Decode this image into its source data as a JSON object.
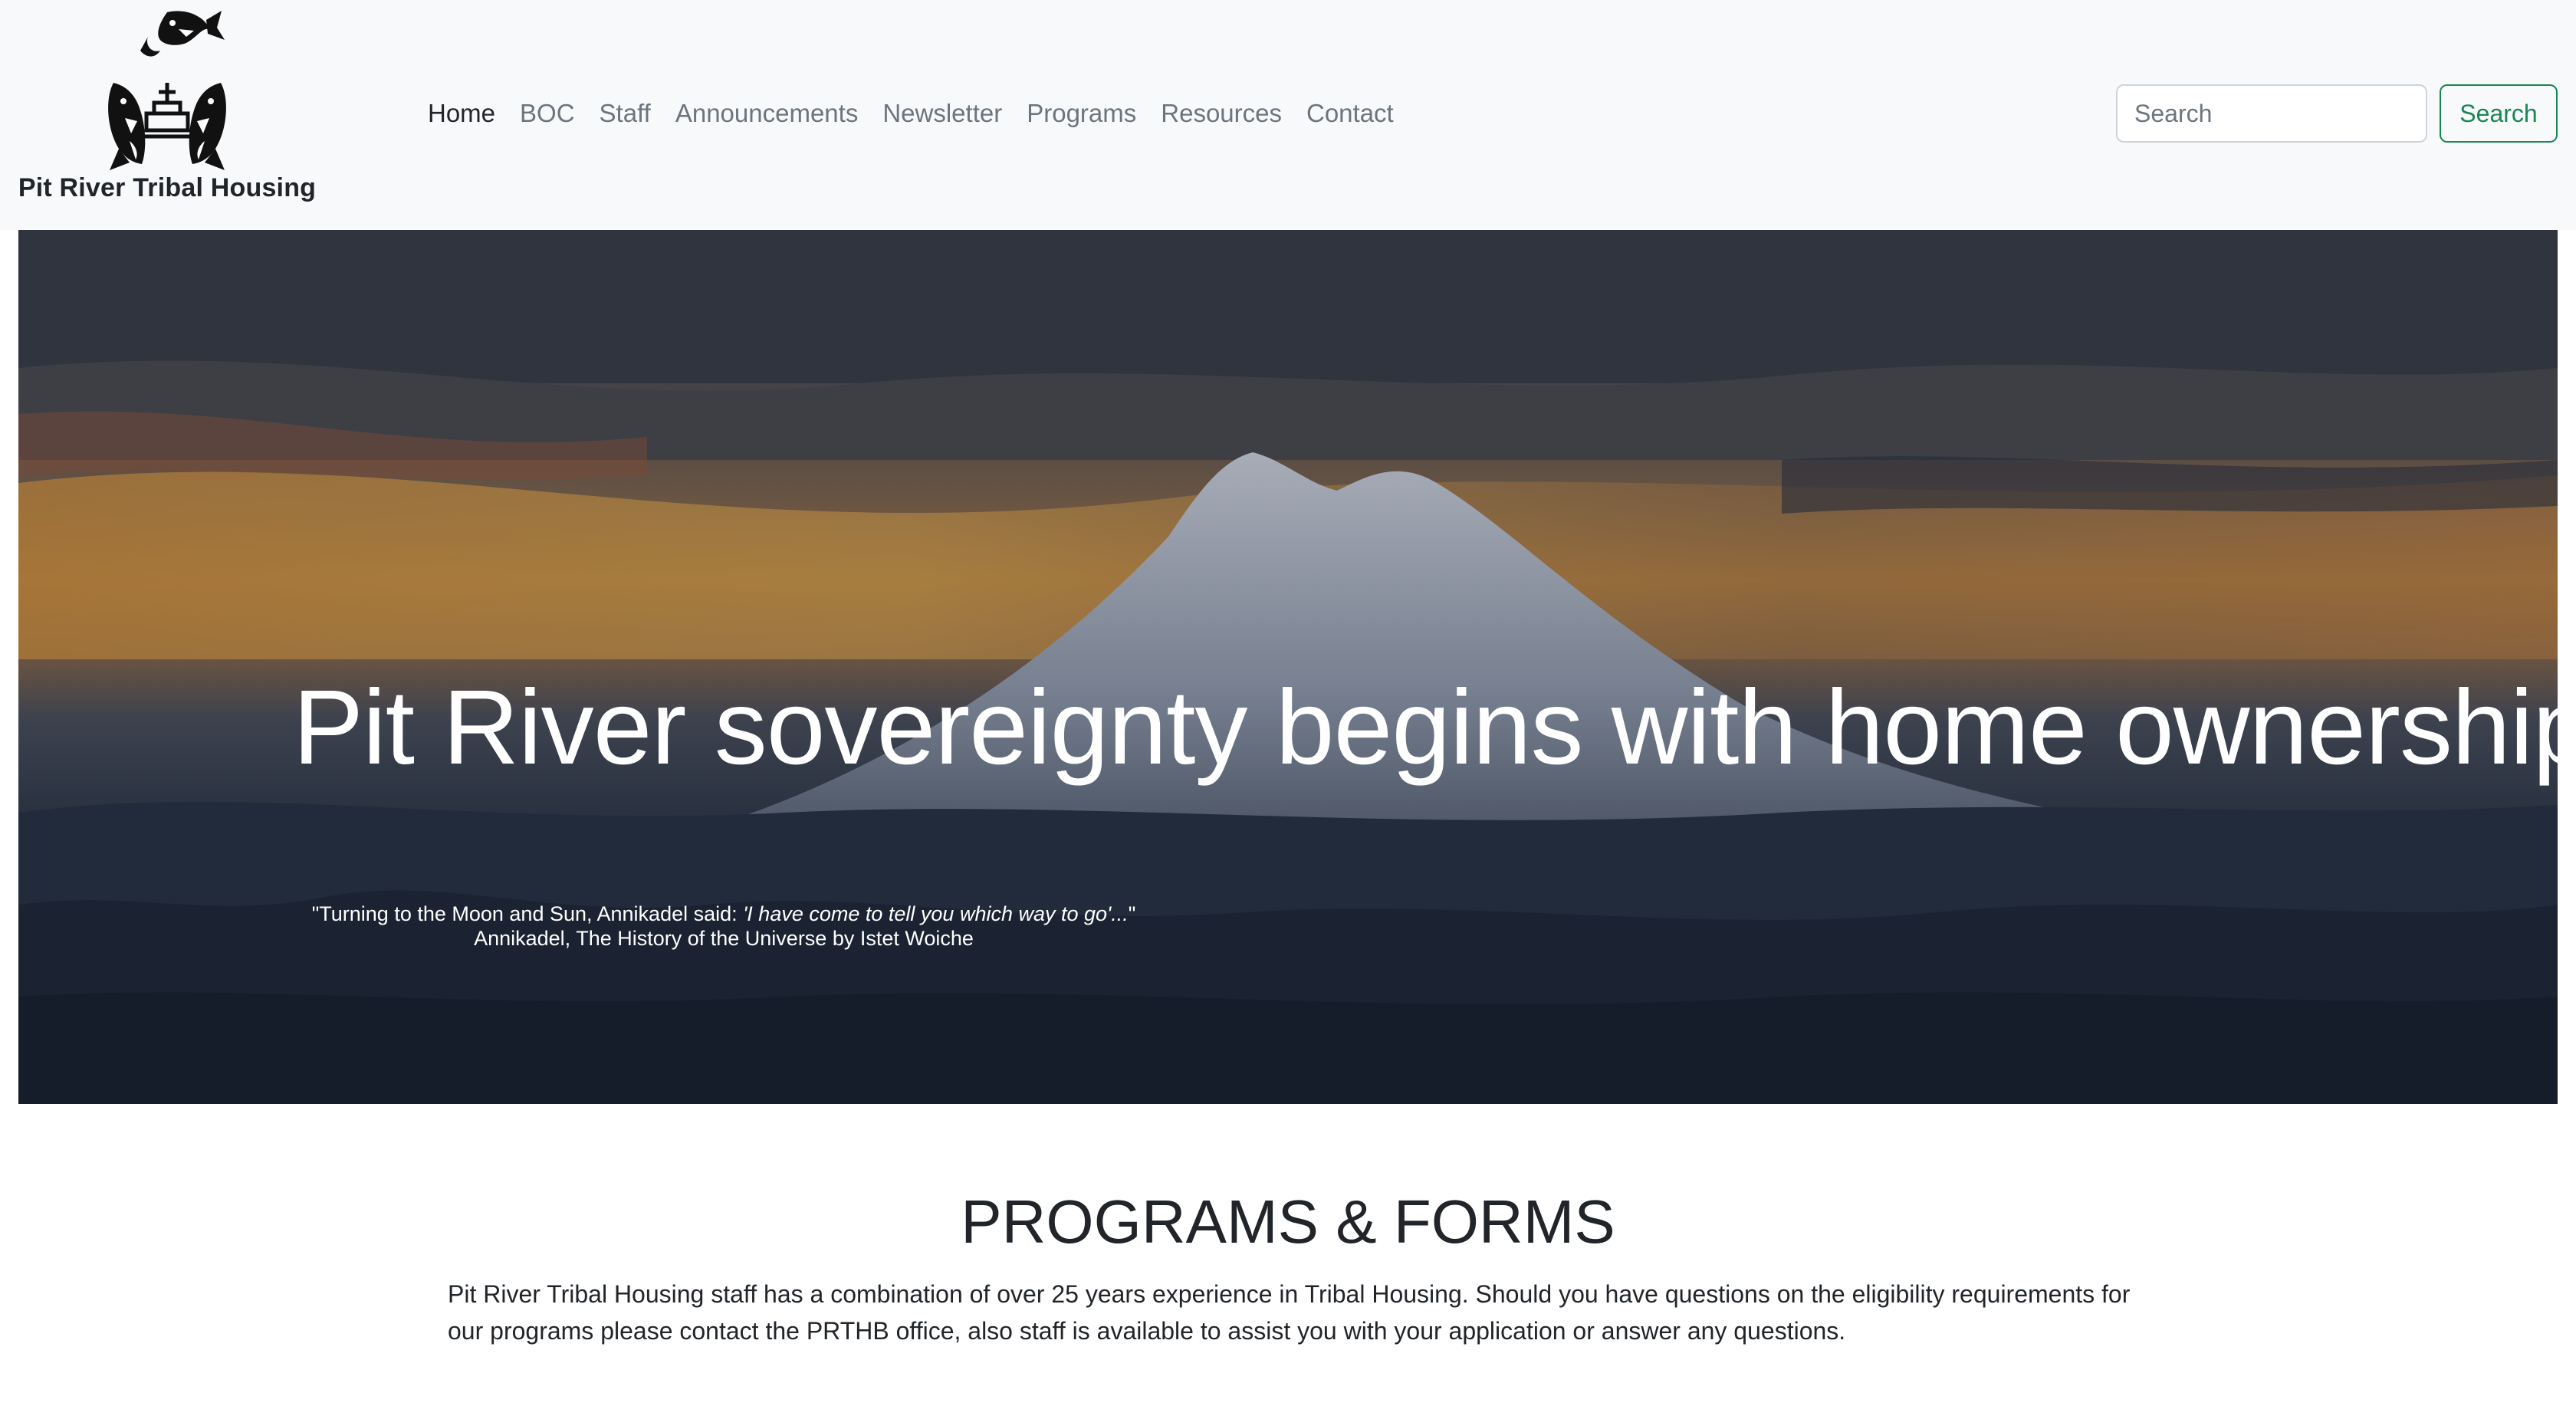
{
  "brand": {
    "name": "Pit River Tribal Housing",
    "logo_icon": "fish-circle-logo-icon"
  },
  "nav": {
    "items": [
      {
        "label": "Home",
        "active": true
      },
      {
        "label": "BOC",
        "active": false
      },
      {
        "label": "Staff",
        "active": false
      },
      {
        "label": "Announcements",
        "active": false
      },
      {
        "label": "Newsletter",
        "active": false
      },
      {
        "label": "Programs",
        "active": false
      },
      {
        "label": "Resources",
        "active": false
      },
      {
        "label": "Contact",
        "active": false
      }
    ]
  },
  "search": {
    "placeholder": "Search",
    "value": "",
    "button_label": "Search"
  },
  "hero": {
    "title": "Pit River sovereignty begins with home ownership",
    "quote_prefix": "\"Turning to the Moon and Sun, Annikadel said: ",
    "quote_italic": "'I have come to tell you which way to go'...",
    "quote_suffix": "\"",
    "attribution": "Annikadel, The History of the Universe by Istet Woiche",
    "background_icon": "mount-shasta-sunset-image"
  },
  "programs": {
    "title": "PROGRAMS & FORMS",
    "text": "Pit River Tribal Housing staff has a combination of over 25 years experience in Tribal Housing. Should you have questions on the eligibility requirements for our programs please contact the PRTHB office, also staff is available to assist you with your application or answer any questions."
  },
  "colors": {
    "navbar_bg": "#f8f9fa",
    "nav_active": "#212529",
    "nav_muted": "#6c757d",
    "search_button": "#198754"
  }
}
